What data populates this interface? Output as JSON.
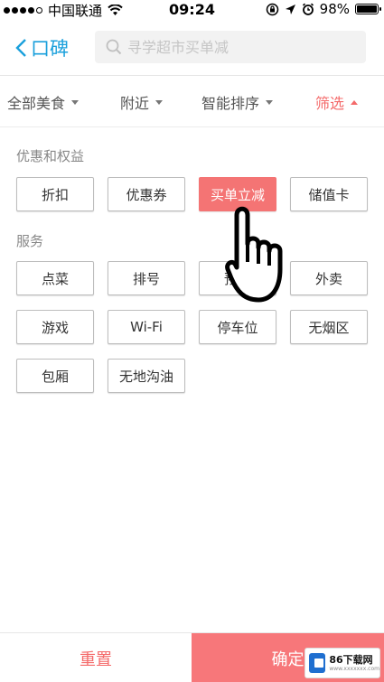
{
  "status_bar": {
    "carrier": "中国联通",
    "time": "09:24",
    "battery": "98%",
    "battery_level": 0.98
  },
  "nav": {
    "back_label": "口碑",
    "search_placeholder": "寻学超市买单减"
  },
  "filters": [
    {
      "label": "全部美食",
      "active": false
    },
    {
      "label": "附近",
      "active": false
    },
    {
      "label": "智能排序",
      "active": false
    },
    {
      "label": "筛选",
      "active": true
    }
  ],
  "sections": {
    "benefits": {
      "title": "优惠和权益",
      "chips": [
        {
          "label": "折扣",
          "selected": false
        },
        {
          "label": "优惠券",
          "selected": false
        },
        {
          "label": "买单立减",
          "selected": true
        },
        {
          "label": "储值卡",
          "selected": false
        }
      ]
    },
    "services": {
      "title": "服务",
      "chips": [
        {
          "label": "点菜",
          "selected": false
        },
        {
          "label": "排号",
          "selected": false
        },
        {
          "label": "预订",
          "selected": false
        },
        {
          "label": "外卖",
          "selected": false
        },
        {
          "label": "游戏",
          "selected": false
        },
        {
          "label": "Wi-Fi",
          "selected": false
        },
        {
          "label": "停车位",
          "selected": false
        },
        {
          "label": "无烟区",
          "selected": false
        },
        {
          "label": "包厢",
          "selected": false
        },
        {
          "label": "无地沟油",
          "selected": false
        }
      ]
    }
  },
  "footer": {
    "reset_label": "重置",
    "confirm_label": "确定"
  },
  "watermark": {
    "brand": "86下载网",
    "url": "www.xxxxxxx.com"
  },
  "colors": {
    "accent": "#f46a6a",
    "link": "#1aa0dc",
    "selected_chip": "#f47474"
  }
}
